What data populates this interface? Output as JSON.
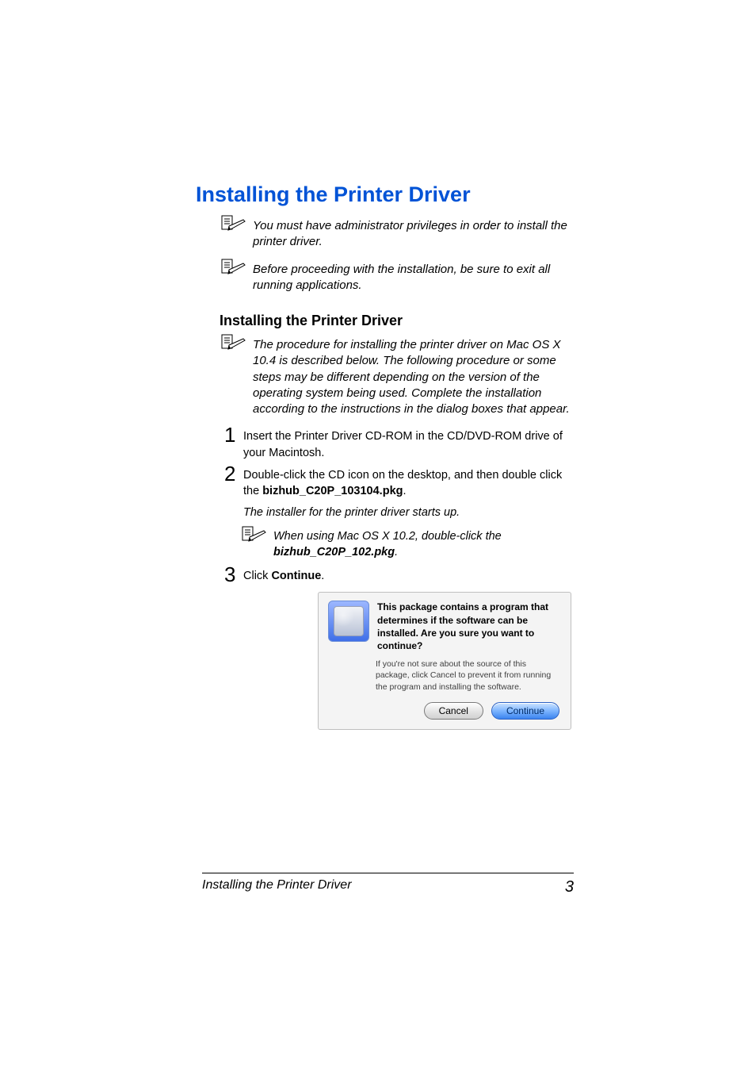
{
  "heading": "Installing the Printer Driver",
  "note1": "You must have administrator privileges in order to install the printer driver.",
  "note2": "Before proceeding with the installation, be sure to exit all running applications.",
  "subheading": "Installing the Printer Driver",
  "note3": "The procedure for installing the printer driver on Mac OS X 10.4 is described below. The following procedure or some steps may be different depending on the version of the operating system being used. Complete the installation according to the instructions in the dialog boxes that appear.",
  "steps": {
    "s1": "Insert the Printer Driver CD-ROM in the CD/DVD-ROM drive of your Macintosh.",
    "s2_pre": "Double-click the CD icon on the desktop, and then double click the ",
    "s2_bold": "bizhub_C20P_103104.pkg",
    "s2_post": ".",
    "s2_after": "The installer for the printer driver starts up.",
    "s2_note_pre": "When using Mac OS X 10.2, double-click the ",
    "s2_note_bold": "bizhub_C20P_102.pkg",
    "s2_note_post": ".",
    "s3_pre": "Click ",
    "s3_bold": "Continue",
    "s3_post": "."
  },
  "nums": {
    "n1": "1",
    "n2": "2",
    "n3": "3"
  },
  "dialog": {
    "message": "This package contains a program that determines if the software can be installed.  Are you sure you want to continue?",
    "explain": "If you're not sure about the source of this package, click Cancel to prevent it from running the program and installing the software.",
    "cancel": "Cancel",
    "continue": "Continue"
  },
  "footer": {
    "title": "Installing the Printer Driver",
    "page": "3"
  }
}
